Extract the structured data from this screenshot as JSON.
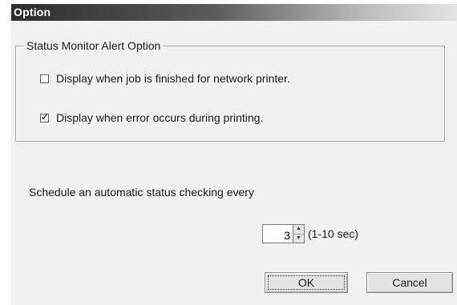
{
  "window": {
    "title": "Option"
  },
  "group": {
    "legend": "Status Monitor Alert Option",
    "options": [
      {
        "label": "Display when job is finished for network printer.",
        "checked": false
      },
      {
        "label": "Display when error occurs during printing.",
        "checked": true
      }
    ]
  },
  "schedule": {
    "label": "Schedule an automatic status checking every",
    "value": "3",
    "range": "(1-10 sec)"
  },
  "buttons": {
    "ok": "OK",
    "cancel": "Cancel"
  },
  "icons": {
    "spin_up": "spin-up-arrow-icon",
    "spin_down": "spin-down-arrow-icon"
  }
}
